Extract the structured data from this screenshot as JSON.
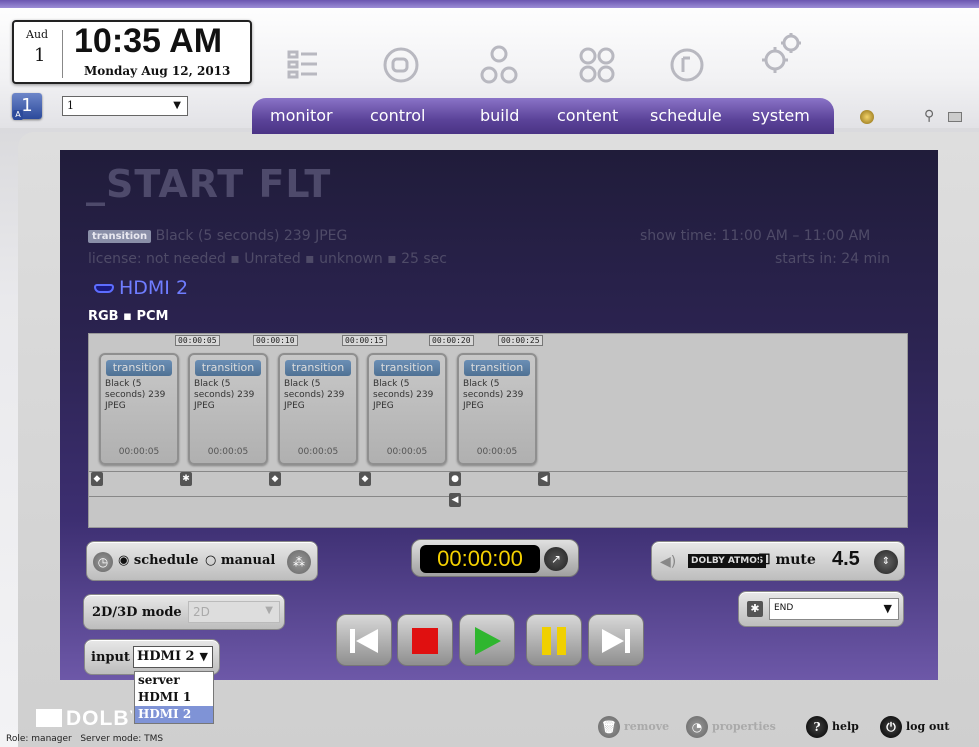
{
  "clock": {
    "month": "Aud",
    "day": "1",
    "time": "10:35 AM",
    "date": "Monday Aug 12, 2013"
  },
  "nav_icons": [
    "monitor-icon",
    "control-icon",
    "build-icon",
    "content-icon",
    "schedule-icon",
    "system-icon"
  ],
  "screen": {
    "badge": "1",
    "badge_sub": "A",
    "select_value": "1"
  },
  "tabs": [
    "monitor",
    "control",
    "build",
    "content",
    "schedule",
    "system"
  ],
  "show": {
    "title": "_START FLT",
    "tag": "transition",
    "description": "Black (5 seconds) 239 JPEG",
    "license_line": "license: not needed ▪ Unrated ▪ unknown ▪ 25 sec",
    "show_time": "show time: 11:00 AM – 11:00 AM",
    "starts_in": "starts in: 24 min",
    "input_name": "HDMI 2",
    "format_line": "RGB ▪ PCM"
  },
  "timeline": {
    "timestamps": [
      "00:00:05",
      "00:00:10",
      "00:00:15",
      "00:00:20",
      "00:00:25"
    ],
    "clips": [
      {
        "tag": "transition",
        "text": "Black (5 seconds) 239 JPEG",
        "duration": "00:00:05"
      },
      {
        "tag": "transition",
        "text": "Black (5 seconds) 239 JPEG",
        "duration": "00:00:05"
      },
      {
        "tag": "transition",
        "text": "Black (5 seconds) 239 JPEG",
        "duration": "00:00:05"
      },
      {
        "tag": "transition",
        "text": "Black (5 seconds) 239 JPEG",
        "duration": "00:00:05"
      },
      {
        "tag": "transition",
        "text": "Black (5 seconds) 239 JPEG",
        "duration": "00:00:05"
      }
    ]
  },
  "controls": {
    "schedule_label": "schedule",
    "manual_label": "manual",
    "timer": "00:00:00",
    "dolby_label": "DOLBY ATMOS",
    "mute_label": "mute",
    "volume": "4.5",
    "mode_label": "2D/3D mode",
    "mode_value": "2D",
    "end_value": "END",
    "input_label": "input",
    "input_value": "HDMI 2",
    "input_options": [
      "server",
      "HDMI 1",
      "HDMI 2"
    ]
  },
  "footer": {
    "logo": "DOLBY",
    "role": "Role: manager",
    "server_mode": "Server mode: TMS",
    "remove": "remove",
    "properties": "properties",
    "help": "help",
    "logout": "log out"
  }
}
